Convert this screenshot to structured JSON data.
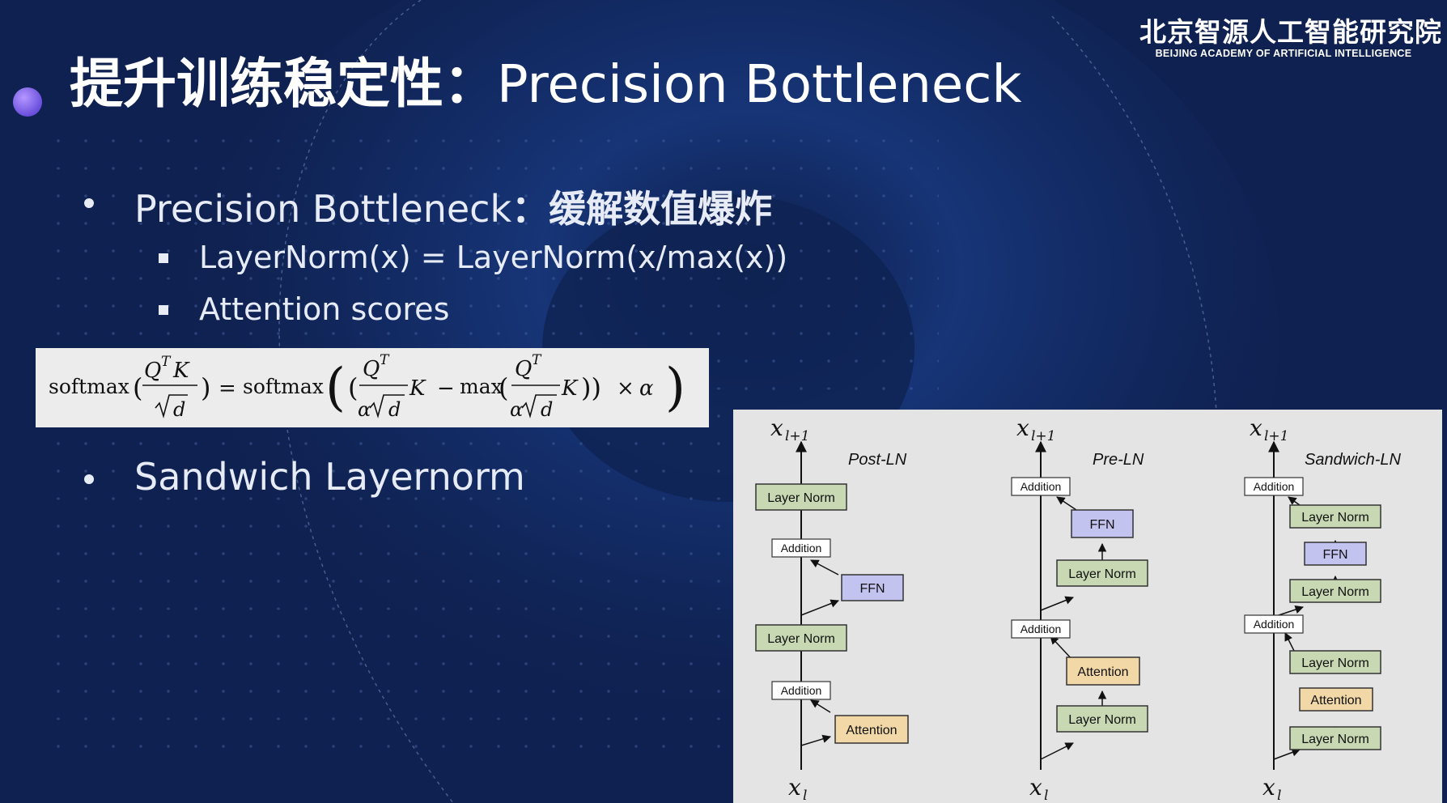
{
  "header": {
    "title_cn": "提升训练稳定性：",
    "title_en": "Precision Bottleneck",
    "org_cn": "北京智源人工智能研究院",
    "org_en": "BEIJING ACADEMY OF ARTIFICIAL INTELLIGENCE"
  },
  "bullets": {
    "b1_en": "Precision Bottleneck",
    "b1_cn": "：缓解数值爆炸",
    "sub1": "LayerNorm(x) = LayerNorm(x/max(x))",
    "sub2": "Attention scores",
    "b2": "Sandwich Layernorm"
  },
  "equation": {
    "softmax": "softmax",
    "eq": "=",
    "minus": "−",
    "max": "max",
    "times": "×",
    "Q": "Q",
    "T": "T",
    "K": "K",
    "d": "d",
    "alpha": "α"
  },
  "diagram": {
    "columns": [
      {
        "title": "Post-LN",
        "top": "x",
        "top_sub": "l+1",
        "bottom": "x",
        "bottom_sub": "l",
        "blocks": [
          "Layer Norm",
          "Addition",
          "FFN",
          "Layer Norm",
          "Addition",
          "Attention"
        ]
      },
      {
        "title": "Pre-LN",
        "top": "x",
        "top_sub": "l+1",
        "bottom": "x",
        "bottom_sub": "l",
        "blocks": [
          "Addition",
          "FFN",
          "Layer Norm",
          "Addition",
          "Attention",
          "Layer Norm"
        ]
      },
      {
        "title": "Sandwich-LN",
        "top": "x",
        "top_sub": "l+1",
        "bottom": "x",
        "bottom_sub": "l",
        "blocks": [
          "Addition",
          "Layer Norm",
          "FFN",
          "Layer Norm",
          "Addition",
          "Layer Norm",
          "Attention",
          "Layer Norm"
        ]
      }
    ]
  },
  "colors": {
    "background": "#0f2150",
    "layer_norm": "#c7d8b3",
    "ffn": "#c3c3f0",
    "attention": "#f2d8a7",
    "addition": "#ffffff",
    "text": "#e6ebf5"
  }
}
